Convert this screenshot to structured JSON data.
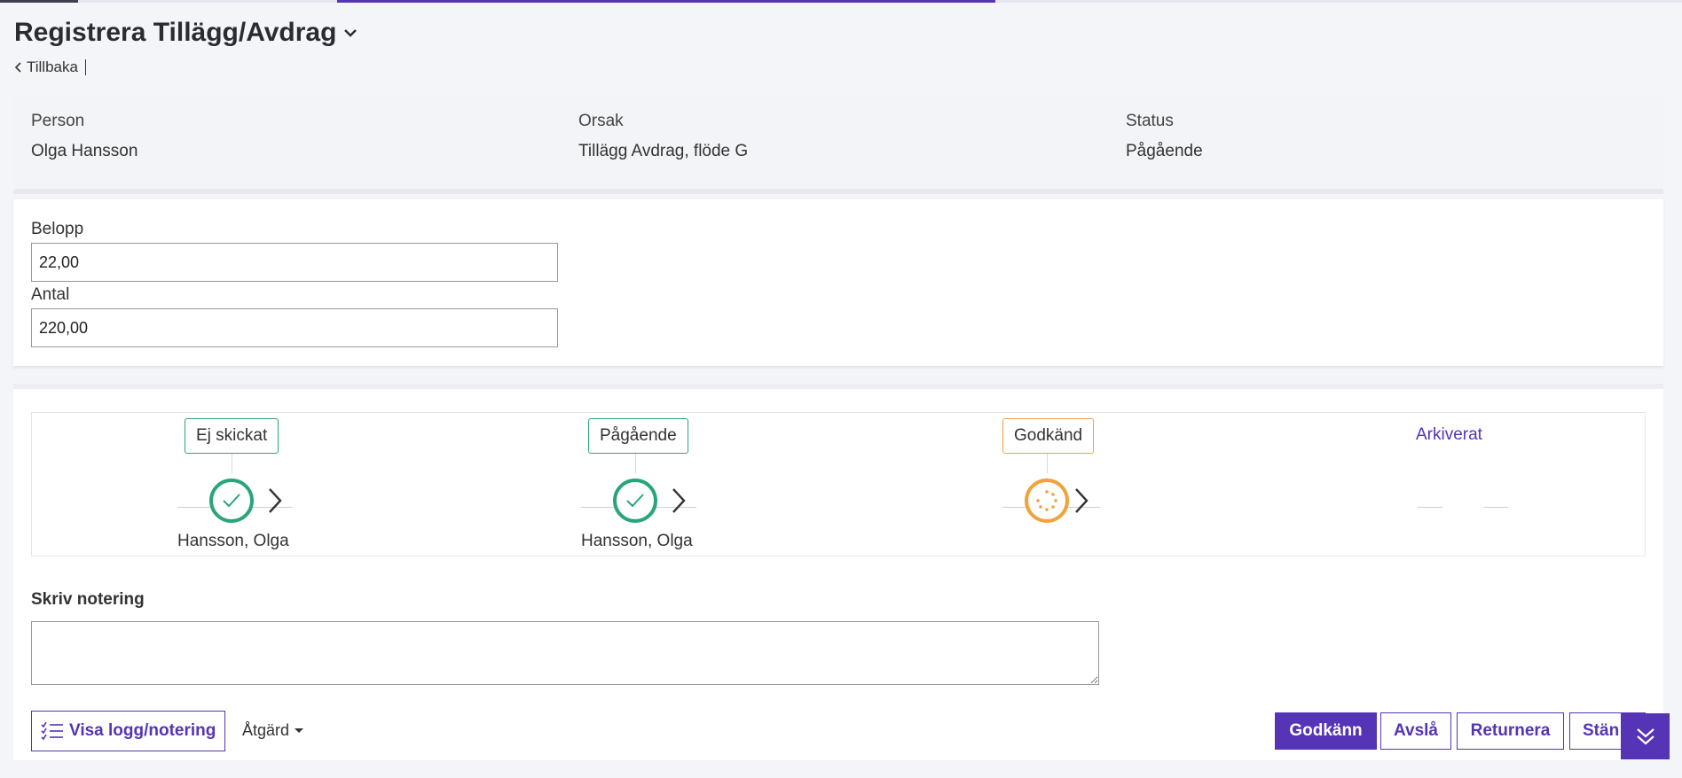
{
  "page": {
    "title": "Registrera Tillägg/Avdrag",
    "back_label": "Tillbaka"
  },
  "info": {
    "person_label": "Person",
    "person_value": "Olga Hansson",
    "orsak_label": "Orsak",
    "orsak_value": "Tillägg Avdrag, flöde G",
    "status_label": "Status",
    "status_value": "Pågående"
  },
  "form": {
    "belopp_label": "Belopp",
    "belopp_value": "22,00",
    "antal_label": "Antal",
    "antal_value": "220,00"
  },
  "workflow": {
    "steps": [
      {
        "label": "Ej skickat",
        "person": "Hansson, Olga",
        "state": "done"
      },
      {
        "label": "Pågående",
        "person": "Hansson, Olga",
        "state": "done"
      },
      {
        "label": "Godkänd",
        "person": "",
        "state": "in-progress"
      },
      {
        "label": "Arkiverat",
        "person": "",
        "state": "pending"
      }
    ]
  },
  "note": {
    "label": "Skriv notering",
    "value": ""
  },
  "footer": {
    "log_button": "Visa logg/notering",
    "action_menu": "Åtgärd",
    "approve": "Godkänn",
    "reject": "Avslå",
    "return": "Returnera",
    "close": "Stän"
  },
  "colors": {
    "accent": "#5534b5",
    "done": "#2aa57a",
    "in_progress": "#f0a33a"
  }
}
